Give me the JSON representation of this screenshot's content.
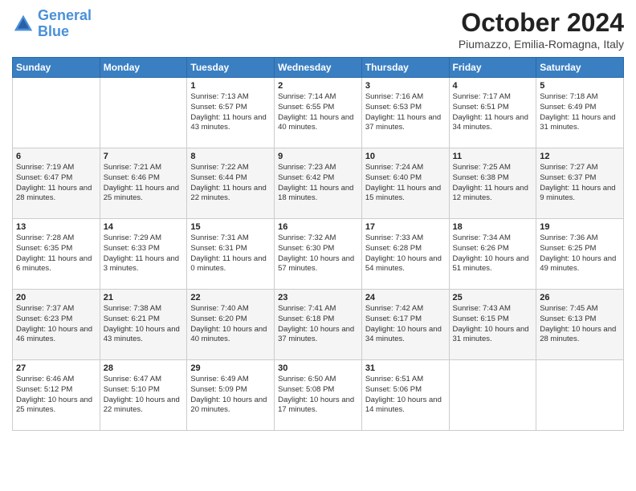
{
  "header": {
    "logo_line1": "General",
    "logo_line2": "Blue",
    "month": "October 2024",
    "location": "Piumazzo, Emilia-Romagna, Italy"
  },
  "days_of_week": [
    "Sunday",
    "Monday",
    "Tuesday",
    "Wednesday",
    "Thursday",
    "Friday",
    "Saturday"
  ],
  "weeks": [
    [
      {
        "day": "",
        "sunrise": "",
        "sunset": "",
        "daylight": ""
      },
      {
        "day": "",
        "sunrise": "",
        "sunset": "",
        "daylight": ""
      },
      {
        "day": "1",
        "sunrise": "Sunrise: 7:13 AM",
        "sunset": "Sunset: 6:57 PM",
        "daylight": "Daylight: 11 hours and 43 minutes."
      },
      {
        "day": "2",
        "sunrise": "Sunrise: 7:14 AM",
        "sunset": "Sunset: 6:55 PM",
        "daylight": "Daylight: 11 hours and 40 minutes."
      },
      {
        "day": "3",
        "sunrise": "Sunrise: 7:16 AM",
        "sunset": "Sunset: 6:53 PM",
        "daylight": "Daylight: 11 hours and 37 minutes."
      },
      {
        "day": "4",
        "sunrise": "Sunrise: 7:17 AM",
        "sunset": "Sunset: 6:51 PM",
        "daylight": "Daylight: 11 hours and 34 minutes."
      },
      {
        "day": "5",
        "sunrise": "Sunrise: 7:18 AM",
        "sunset": "Sunset: 6:49 PM",
        "daylight": "Daylight: 11 hours and 31 minutes."
      }
    ],
    [
      {
        "day": "6",
        "sunrise": "Sunrise: 7:19 AM",
        "sunset": "Sunset: 6:47 PM",
        "daylight": "Daylight: 11 hours and 28 minutes."
      },
      {
        "day": "7",
        "sunrise": "Sunrise: 7:21 AM",
        "sunset": "Sunset: 6:46 PM",
        "daylight": "Daylight: 11 hours and 25 minutes."
      },
      {
        "day": "8",
        "sunrise": "Sunrise: 7:22 AM",
        "sunset": "Sunset: 6:44 PM",
        "daylight": "Daylight: 11 hours and 22 minutes."
      },
      {
        "day": "9",
        "sunrise": "Sunrise: 7:23 AM",
        "sunset": "Sunset: 6:42 PM",
        "daylight": "Daylight: 11 hours and 18 minutes."
      },
      {
        "day": "10",
        "sunrise": "Sunrise: 7:24 AM",
        "sunset": "Sunset: 6:40 PM",
        "daylight": "Daylight: 11 hours and 15 minutes."
      },
      {
        "day": "11",
        "sunrise": "Sunrise: 7:25 AM",
        "sunset": "Sunset: 6:38 PM",
        "daylight": "Daylight: 11 hours and 12 minutes."
      },
      {
        "day": "12",
        "sunrise": "Sunrise: 7:27 AM",
        "sunset": "Sunset: 6:37 PM",
        "daylight": "Daylight: 11 hours and 9 minutes."
      }
    ],
    [
      {
        "day": "13",
        "sunrise": "Sunrise: 7:28 AM",
        "sunset": "Sunset: 6:35 PM",
        "daylight": "Daylight: 11 hours and 6 minutes."
      },
      {
        "day": "14",
        "sunrise": "Sunrise: 7:29 AM",
        "sunset": "Sunset: 6:33 PM",
        "daylight": "Daylight: 11 hours and 3 minutes."
      },
      {
        "day": "15",
        "sunrise": "Sunrise: 7:31 AM",
        "sunset": "Sunset: 6:31 PM",
        "daylight": "Daylight: 11 hours and 0 minutes."
      },
      {
        "day": "16",
        "sunrise": "Sunrise: 7:32 AM",
        "sunset": "Sunset: 6:30 PM",
        "daylight": "Daylight: 10 hours and 57 minutes."
      },
      {
        "day": "17",
        "sunrise": "Sunrise: 7:33 AM",
        "sunset": "Sunset: 6:28 PM",
        "daylight": "Daylight: 10 hours and 54 minutes."
      },
      {
        "day": "18",
        "sunrise": "Sunrise: 7:34 AM",
        "sunset": "Sunset: 6:26 PM",
        "daylight": "Daylight: 10 hours and 51 minutes."
      },
      {
        "day": "19",
        "sunrise": "Sunrise: 7:36 AM",
        "sunset": "Sunset: 6:25 PM",
        "daylight": "Daylight: 10 hours and 49 minutes."
      }
    ],
    [
      {
        "day": "20",
        "sunrise": "Sunrise: 7:37 AM",
        "sunset": "Sunset: 6:23 PM",
        "daylight": "Daylight: 10 hours and 46 minutes."
      },
      {
        "day": "21",
        "sunrise": "Sunrise: 7:38 AM",
        "sunset": "Sunset: 6:21 PM",
        "daylight": "Daylight: 10 hours and 43 minutes."
      },
      {
        "day": "22",
        "sunrise": "Sunrise: 7:40 AM",
        "sunset": "Sunset: 6:20 PM",
        "daylight": "Daylight: 10 hours and 40 minutes."
      },
      {
        "day": "23",
        "sunrise": "Sunrise: 7:41 AM",
        "sunset": "Sunset: 6:18 PM",
        "daylight": "Daylight: 10 hours and 37 minutes."
      },
      {
        "day": "24",
        "sunrise": "Sunrise: 7:42 AM",
        "sunset": "Sunset: 6:17 PM",
        "daylight": "Daylight: 10 hours and 34 minutes."
      },
      {
        "day": "25",
        "sunrise": "Sunrise: 7:43 AM",
        "sunset": "Sunset: 6:15 PM",
        "daylight": "Daylight: 10 hours and 31 minutes."
      },
      {
        "day": "26",
        "sunrise": "Sunrise: 7:45 AM",
        "sunset": "Sunset: 6:13 PM",
        "daylight": "Daylight: 10 hours and 28 minutes."
      }
    ],
    [
      {
        "day": "27",
        "sunrise": "Sunrise: 6:46 AM",
        "sunset": "Sunset: 5:12 PM",
        "daylight": "Daylight: 10 hours and 25 minutes."
      },
      {
        "day": "28",
        "sunrise": "Sunrise: 6:47 AM",
        "sunset": "Sunset: 5:10 PM",
        "daylight": "Daylight: 10 hours and 22 minutes."
      },
      {
        "day": "29",
        "sunrise": "Sunrise: 6:49 AM",
        "sunset": "Sunset: 5:09 PM",
        "daylight": "Daylight: 10 hours and 20 minutes."
      },
      {
        "day": "30",
        "sunrise": "Sunrise: 6:50 AM",
        "sunset": "Sunset: 5:08 PM",
        "daylight": "Daylight: 10 hours and 17 minutes."
      },
      {
        "day": "31",
        "sunrise": "Sunrise: 6:51 AM",
        "sunset": "Sunset: 5:06 PM",
        "daylight": "Daylight: 10 hours and 14 minutes."
      },
      {
        "day": "",
        "sunrise": "",
        "sunset": "",
        "daylight": ""
      },
      {
        "day": "",
        "sunrise": "",
        "sunset": "",
        "daylight": ""
      }
    ]
  ]
}
